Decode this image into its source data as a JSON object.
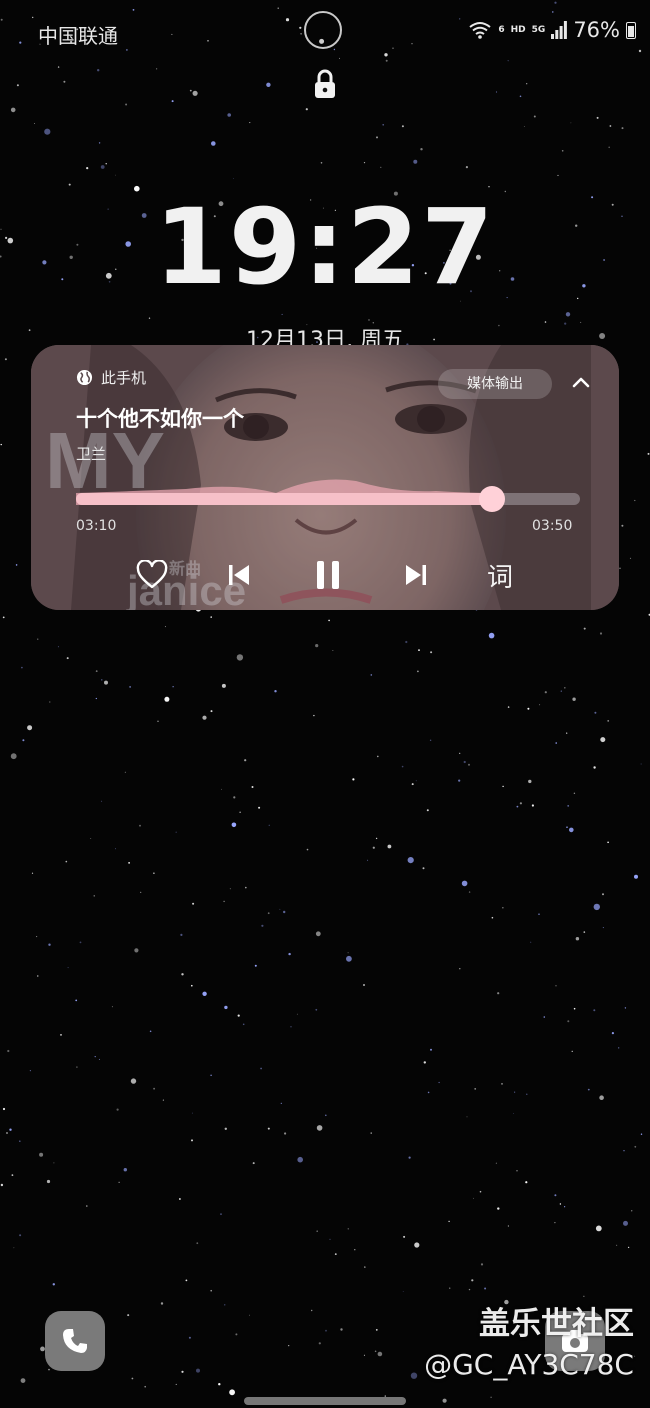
{
  "status_bar": {
    "carrier": "中国联通",
    "wifi_tag": "6",
    "hd_tag": "HD",
    "network_tag": "5G",
    "battery_percent": "76%",
    "battery_level": 0.76
  },
  "lock_screen": {
    "time": "19:27",
    "date": "12月13日, 周五"
  },
  "media_player": {
    "output_device": "此手机",
    "output_button_label": "媒体输出",
    "song_title": "十个他不如你一个",
    "artist": "卫兰",
    "elapsed": "03:10",
    "duration": "03:50",
    "progress": 0.826,
    "lyrics_button": "词",
    "album_art_text": {
      "big": "MY",
      "name": "janice",
      "sub": "新曲"
    },
    "accent_color": "#ffd1d8"
  },
  "shortcuts": {
    "left": "phone-icon",
    "right": "camera-icon"
  },
  "watermark": {
    "line1": "盖乐世社区",
    "line2": "@GC_AY3C78C"
  }
}
